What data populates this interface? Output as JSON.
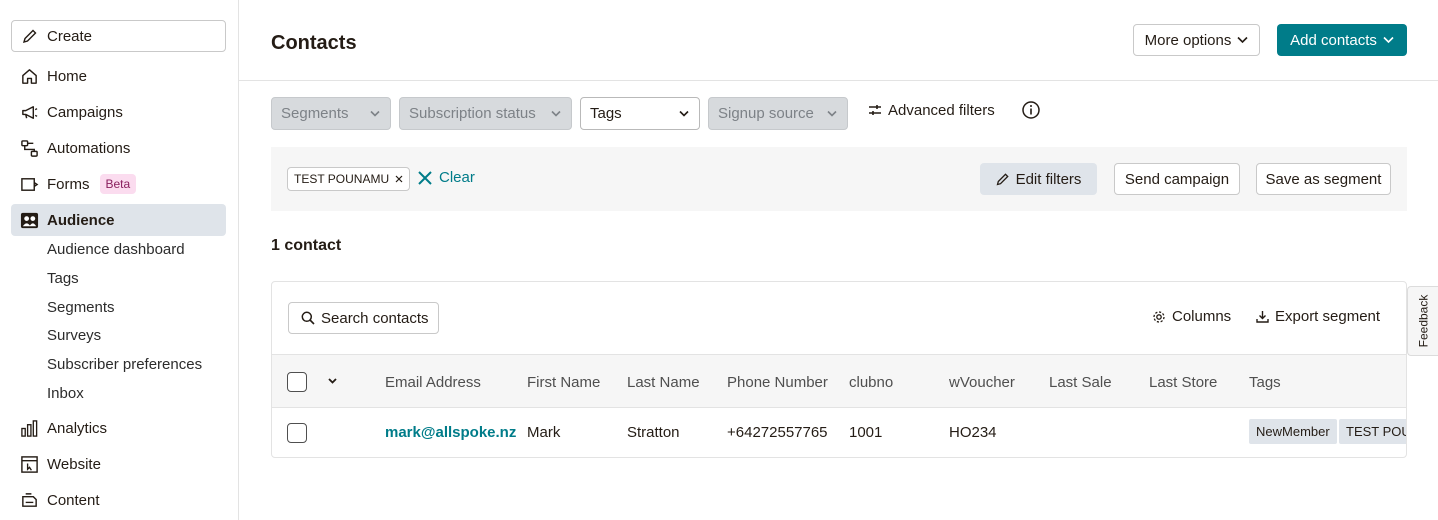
{
  "sidebar": {
    "create_label": "Create",
    "items": [
      {
        "label": "Home",
        "icon": "home-icon"
      },
      {
        "label": "Campaigns",
        "icon": "megaphone-icon"
      },
      {
        "label": "Automations",
        "icon": "automation-icon"
      },
      {
        "label": "Forms",
        "icon": "form-icon",
        "badge": "Beta"
      },
      {
        "label": "Audience",
        "icon": "audience-icon",
        "active": true
      },
      {
        "label": "Analytics",
        "icon": "bar-chart-icon"
      },
      {
        "label": "Website",
        "icon": "website-icon"
      },
      {
        "label": "Content",
        "icon": "content-icon"
      }
    ],
    "audience_sub": [
      "Audience dashboard",
      "Tags",
      "Segments",
      "Surveys",
      "Subscriber preferences",
      "Inbox"
    ]
  },
  "header": {
    "title": "Contacts",
    "more_options": "More options",
    "add_contacts": "Add contacts"
  },
  "filters": {
    "segments": "Segments",
    "subscription_status": "Subscription status",
    "tags": "Tags",
    "signup_source": "Signup source",
    "advanced": "Advanced filters"
  },
  "applied": {
    "chip": "TEST POUNAMU",
    "clear": "Clear",
    "edit_filters": "Edit filters",
    "send_campaign": "Send campaign",
    "save_segment": "Save as segment"
  },
  "count_label": "1 contact",
  "table": {
    "search": "Search contacts",
    "columns_btn": "Columns",
    "export_btn": "Export segment",
    "headers": [
      "Email Address",
      "First Name",
      "Last Name",
      "Phone Number",
      "clubno",
      "wVoucher",
      "Last Sale",
      "Last Store",
      "Tags"
    ],
    "rows": [
      {
        "email": "mark@allspoke.nz",
        "first": "Mark",
        "last": "Stratton",
        "phone": "+64272557765",
        "clubno": "1001",
        "wvoucher": "HO234",
        "last_sale": "",
        "last_store": "",
        "tags": [
          "NewMember",
          "TEST POUNAMU"
        ]
      }
    ]
  },
  "feedback": "Feedback",
  "colors": {
    "brand": "#007c89",
    "active_nav": "#dfe4ea",
    "beta_badge": "#fbdcef"
  }
}
